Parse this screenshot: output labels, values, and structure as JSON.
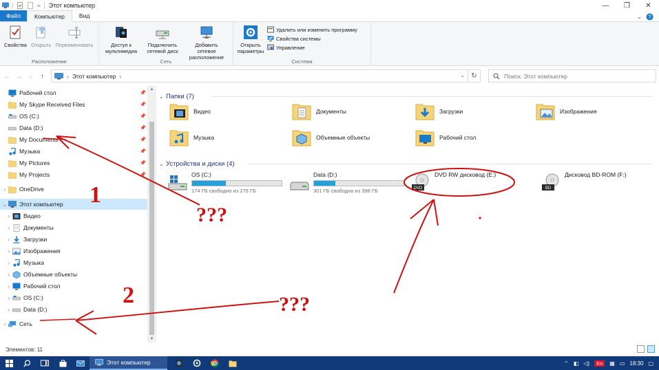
{
  "window": {
    "title": "Этот компьютер",
    "controls": [
      "—",
      "❐",
      "✕"
    ]
  },
  "tabs": [
    {
      "label": "Файл",
      "kind": "file"
    },
    {
      "label": "Компьютер",
      "kind": "active"
    },
    {
      "label": "Вид",
      "kind": "normal"
    }
  ],
  "ribbon": {
    "groups": [
      {
        "label": "Расположение",
        "buttons": [
          "Свойства",
          "Открыть",
          "Переименовать"
        ]
      },
      {
        "label": "Сеть",
        "buttons": [
          "Доступ к мультимедиа",
          "Подключить сетевой диск",
          "Добавить сетевое расположение"
        ]
      },
      {
        "label": "Система",
        "big": "Открыть параметры",
        "small": [
          "Удалить или изменить программу",
          "Свойства системы",
          "Управление"
        ]
      }
    ]
  },
  "address": {
    "path": "Этот компьютер",
    "search_placeholder": "Поиск: Этот компьютер"
  },
  "nav": {
    "quick": [
      "Рабочий стол",
      "My Skype Received Files",
      "OS (C:)",
      "Data (D:)",
      "My Documents",
      "Музыка",
      "My Pictures",
      "My Projects"
    ],
    "onedrive": "OneDrive",
    "thispc": "Этот компьютер",
    "thispc_children": [
      "Видео",
      "Документы",
      "Загрузки",
      "Изображения",
      "Музыка",
      "Объемные объекты",
      "Рабочий стол",
      "OS (C:)",
      "Data (D:)"
    ],
    "network": "Сеть"
  },
  "content": {
    "folders_header": "Папки (7)",
    "folders": [
      "Видео",
      "Документы",
      "Загрузки",
      "Изображения",
      "Музыка",
      "Объемные объекты",
      "Рабочий стол"
    ],
    "devices_header": "Устройства и диски (4)",
    "drives": [
      {
        "name": "OS (C:)",
        "free": "174 ГБ свободно из 279 ГБ",
        "used_fraction": 0.38
      },
      {
        "name": "Data (D:)",
        "free": "301 ГБ свободно из 398 ГБ",
        "used_fraction": 0.24
      },
      {
        "name": "DVD RW дисковод (E:)"
      },
      {
        "name": "Дисковод BD-ROM (F:)"
      }
    ]
  },
  "status": {
    "items": "Элементов: 11"
  },
  "taskbar": {
    "task": "Этот компьютер",
    "lang": "En",
    "time": "18:30"
  },
  "annotations": {
    "one": "1",
    "two": "2",
    "q1": "???",
    "q2": "???"
  },
  "colors": {
    "accent": "#1979ca",
    "annotation": "#cc1111",
    "taskbar": "#103a7a"
  }
}
